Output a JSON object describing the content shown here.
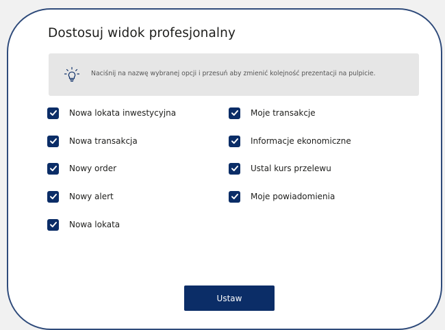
{
  "dialog": {
    "title": "Dostosuj widok profesjonalny",
    "info_text": "Naciśnij na nazwę wybranej opcji i przesuń aby zmienić kolejność prezentacji na pulpicie.",
    "info_icon": "lightbulb-icon",
    "submit_label": "Ustaw"
  },
  "options_left": [
    {
      "label": "Nowa lokata inwestycyjna",
      "checked": true
    },
    {
      "label": "Nowa transakcja",
      "checked": true
    },
    {
      "label": "Nowy order",
      "checked": true
    },
    {
      "label": "Nowy alert",
      "checked": true
    },
    {
      "label": "Nowa lokata",
      "checked": true
    }
  ],
  "options_right": [
    {
      "label": "Moje transakcje",
      "checked": true
    },
    {
      "label": "Informacje ekonomiczne",
      "checked": true
    },
    {
      "label": "Ustal kurs przelewu",
      "checked": true
    },
    {
      "label": "Moje powiadomienia",
      "checked": true
    }
  ],
  "colors": {
    "accent": "#0b2d67",
    "border": "#2e4a7a",
    "info_bg": "#e6e6e6"
  }
}
